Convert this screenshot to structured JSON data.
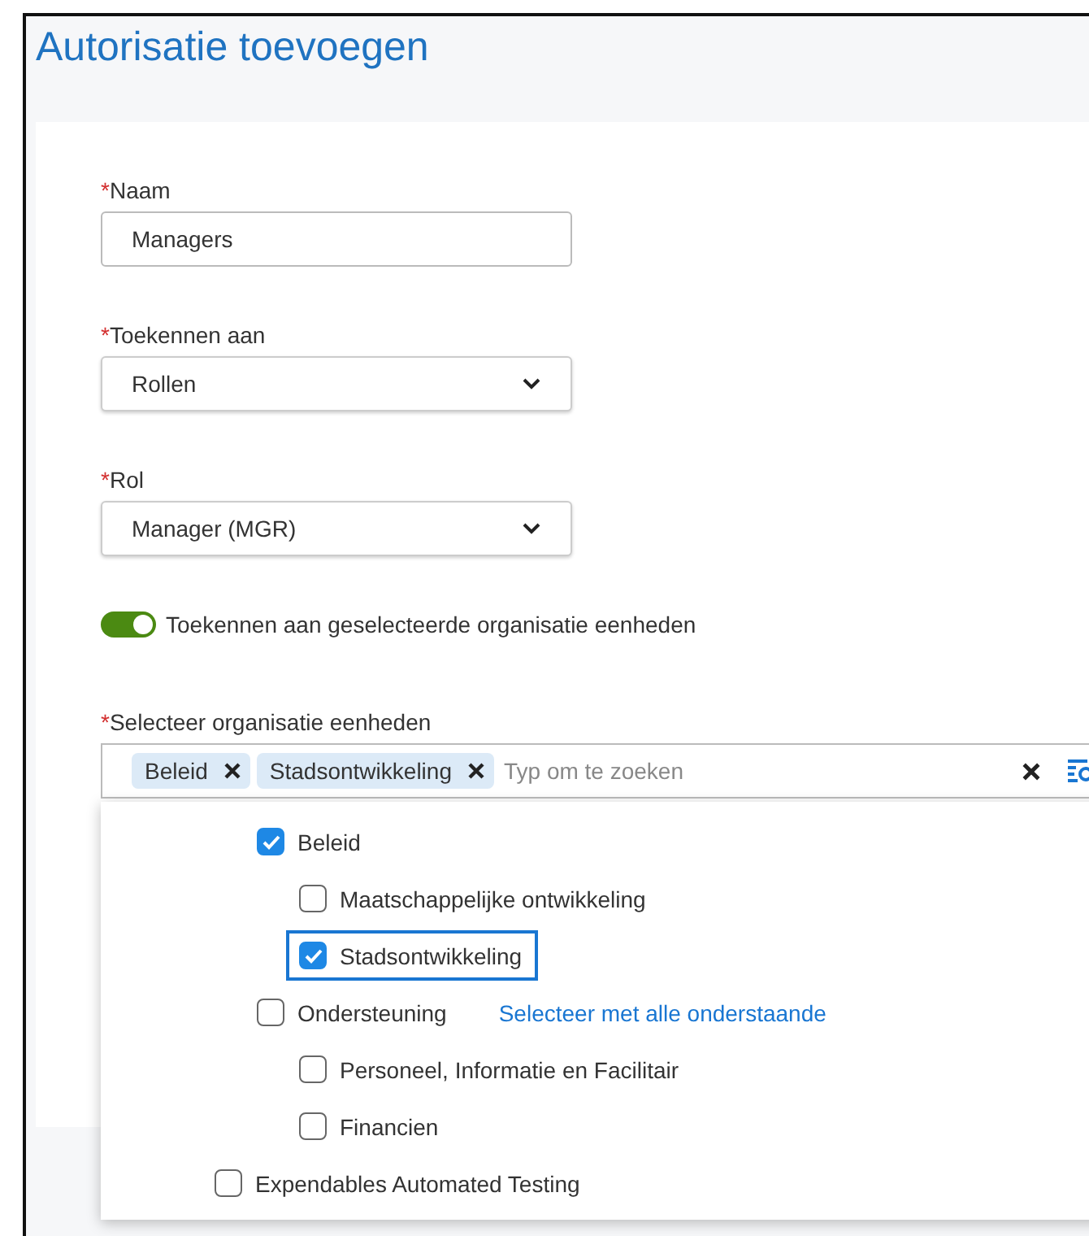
{
  "dialog": {
    "title": "Autorisatie toevoegen"
  },
  "fields": [
    {
      "kind": "input",
      "required_mark": "*",
      "label": "Naam",
      "value": "Managers"
    },
    {
      "kind": "select",
      "required_mark": "*",
      "label": "Toekennen aan",
      "value": "Rollen"
    },
    {
      "kind": "select",
      "required_mark": "*",
      "label": "Rol",
      "value": "Manager (MGR)"
    }
  ],
  "toggle": {
    "label": "Toekennen aan geselecteerde organisatie eenheden",
    "on": true
  },
  "org_select": {
    "required_mark": "*",
    "label": "Selecteer organisatie eenheden",
    "chips": [
      "Beleid",
      "Stadsontwikkeling"
    ],
    "placeholder": "Typ om te zoeken",
    "tree": [
      {
        "children": [
          {
            "label": "Beleid",
            "checked": true,
            "focused": false,
            "children": [
              {
                "label": "Maatschappelijke ontwikkeling",
                "checked": false,
                "focused": false
              },
              {
                "label": "Stadsontwikkeling",
                "checked": true,
                "focused": true
              }
            ]
          },
          {
            "label": "Ondersteuning",
            "checked": false,
            "focused": false,
            "action": "Selecteer met alle onderstaande",
            "children": [
              {
                "label": "Personeel, Informatie en Facilitair",
                "checked": false,
                "focused": false
              },
              {
                "label": "Financien",
                "checked": false,
                "focused": false
              }
            ]
          }
        ]
      },
      {
        "label": "Expendables Automated Testing",
        "checked": false,
        "focused": false
      }
    ]
  }
}
